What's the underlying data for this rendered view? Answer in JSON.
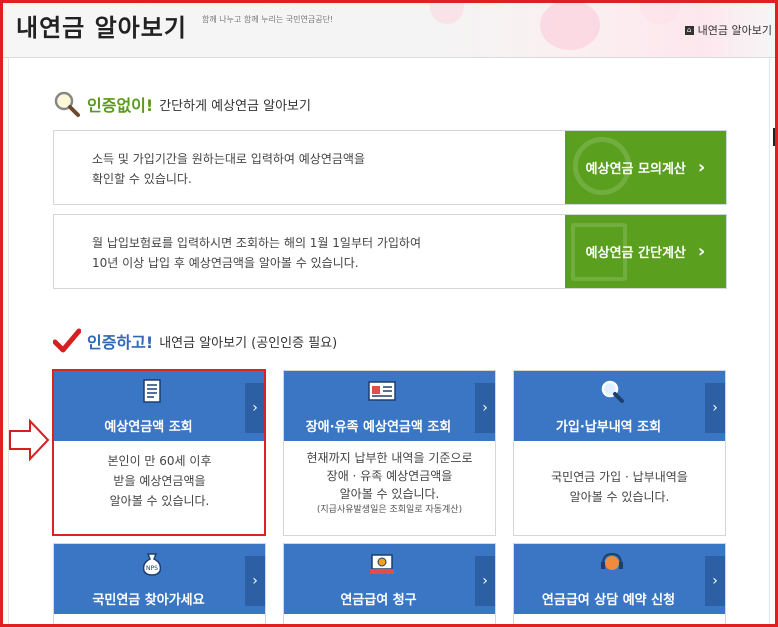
{
  "header": {
    "title": "내연금 알아보기",
    "tagline": "함께 나누고 함께 누리는 국민연금공단!",
    "breadcrumb": "내연금 알아보기",
    "breadcrumb_icon": "home-icon"
  },
  "section1": {
    "strong": "인증없이!",
    "rest": "간단하게 예상연금 알아보기",
    "icon": "magnifier-icon"
  },
  "calc_rows": [
    {
      "line1": "소득 및 가입기간을 원하는대로 입력하여 예상연금액을",
      "line2": "확인할 수 있습니다.",
      "button": "예상연금 모의계산",
      "arrow": "›"
    },
    {
      "line1": "월 납입보험료를 입력하시면 조회하는 해의 1월 1일부터 가입하여",
      "line2": "10년 이상 납입 후 예상연금액을 알아볼 수 있습니다.",
      "button": "예상연금 간단계산",
      "arrow": "›"
    }
  ],
  "section2": {
    "strong": "인증하고!",
    "rest": "내연금 알아보기 (공인인증 필요)",
    "icon": "checkmark-icon"
  },
  "cards": [
    {
      "title": "예상연금액 조회",
      "icon": "document-list-icon",
      "body": [
        "본인이 만 60세 이후",
        "받을 예상연금액을",
        "알아볼 수 있습니다."
      ],
      "note": "",
      "arrow": "›"
    },
    {
      "title": "장애·유족 예상연금액 조회",
      "icon": "id-card-icon",
      "body": [
        "현재까지 납부한 내역을 기준으로",
        "장애 · 유족 예상연금액을",
        "알아볼 수 있습니다."
      ],
      "note": "(지급사유발생일은 조회일로 자동계산)",
      "arrow": "›"
    },
    {
      "title": "가입·납부내역 조회",
      "icon": "search-icon",
      "body": [
        "국민연금 가입 · 납부내역을",
        "알아볼 수 있습니다."
      ],
      "note": "",
      "arrow": "›"
    },
    {
      "title": "국민연금 찾아가세요",
      "icon": "money-bag-icon",
      "arrow": "›"
    },
    {
      "title": "연금급여 청구",
      "icon": "register-icon",
      "arrow": "›"
    },
    {
      "title": "연금급여 상담 예약 신청",
      "icon": "headset-icon",
      "arrow": "›"
    }
  ],
  "colors": {
    "green": "#5aa01e",
    "blue": "#3a76c4",
    "highlight": "#dd2222"
  }
}
